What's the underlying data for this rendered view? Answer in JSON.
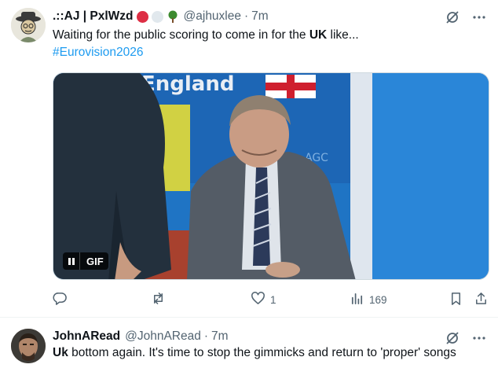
{
  "posts": [
    {
      "display_name": ".::AJ | PxlWzd",
      "handle": "@ajhuxlee",
      "separator": "·",
      "time": "7m",
      "text_before": "Waiting for the public scoring to come in for the ",
      "text_bold": "UK",
      "text_after": " like...",
      "hashtag": "#Eurovision2026",
      "media": {
        "badge": "GIF",
        "banner_text": "England"
      },
      "actions": {
        "replies": "",
        "reposts": "",
        "likes": "1",
        "views": "169"
      }
    },
    {
      "display_name": "JohnARead",
      "handle": "@JohnARead",
      "separator": "·",
      "time": "7m",
      "text_bold": "Uk",
      "text_after": " bottom again. It's time to stop the gimmicks and return to 'proper' songs"
    }
  ],
  "colors": {
    "accent": "#1d9bf0",
    "muted": "#536471",
    "text": "#0f1419"
  },
  "icons": [
    "grok-icon",
    "more-icon",
    "reply-icon",
    "repost-icon",
    "like-icon",
    "views-icon",
    "bookmark-icon",
    "share-icon"
  ]
}
